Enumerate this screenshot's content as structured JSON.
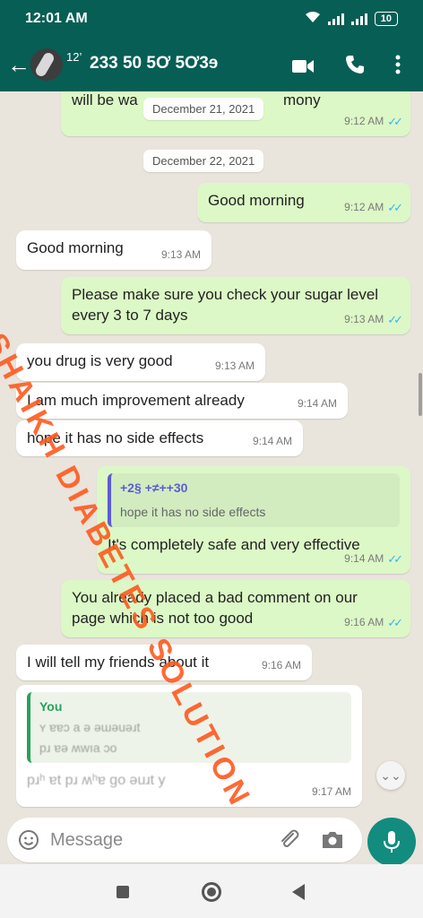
{
  "status_bar": {
    "time": "12:01 AM",
    "battery": "10"
  },
  "header": {
    "contact_prefix": "12’",
    "contact_name": "233 50 5Ơ 5Ơ3ɘ",
    "icons": [
      "back-arrow-icon",
      "avatar",
      "video-call-icon",
      "phone-icon",
      "more-vert-icon"
    ]
  },
  "chat": {
    "top_partial": {
      "text": "will be wa",
      "text_tail": "mony",
      "time": "9:12 AM"
    },
    "date1": "December 21, 2021",
    "date2": "December 22, 2021",
    "messages": [
      {
        "dir": "out",
        "text": "Good morning",
        "time": "9:12 AM"
      },
      {
        "dir": "in",
        "text": "Good morning",
        "time": "9:13 AM"
      },
      {
        "dir": "out",
        "text": "Please make sure you check your sugar level every 3 to 7 days",
        "time": "9:13 AM"
      },
      {
        "dir": "in",
        "text": "you drug is very good",
        "time": "9:13 AM"
      },
      {
        "dir": "in",
        "text": "I am much improvement already",
        "time": "9:14 AM"
      },
      {
        "dir": "in",
        "text": "hope it has no side effects",
        "time": "9:14 AM"
      },
      {
        "dir": "out",
        "quote_author": "+2§  +≠++30",
        "quote_text": "hope it has no side effects",
        "text": "It's completely safe and very effective",
        "time": "9:14 AM"
      },
      {
        "dir": "out",
        "text": "You already placed a bad comment on our page which is not too good",
        "time": "9:16 AM"
      },
      {
        "dir": "in",
        "text": "I will tell my friends about it",
        "time": "9:16 AM"
      },
      {
        "dir": "in",
        "quote_author": "You",
        "quote_line1": "ʏ   ɐɐɔ   a      ǝ      ǝɯǝuǝɹt",
        "quote_line2": "pɹ    ɐǝ  ʍwıa       ɔo",
        "text": "pɹʰ  ɐt pɹ    ʍʰɐ        ɡo       ǝuɹt       y",
        "time": "9:17 AM"
      }
    ]
  },
  "watermark": "DR SHAIKH DIABETES SOLUTION",
  "input": {
    "placeholder": "Message"
  },
  "colors": {
    "header": "#075e54",
    "outgoing": "#dcf8c6",
    "incoming": "#ffffff",
    "ticks": "#34b7f1",
    "mic": "#128c7e",
    "watermark": "#ff5a1f"
  }
}
